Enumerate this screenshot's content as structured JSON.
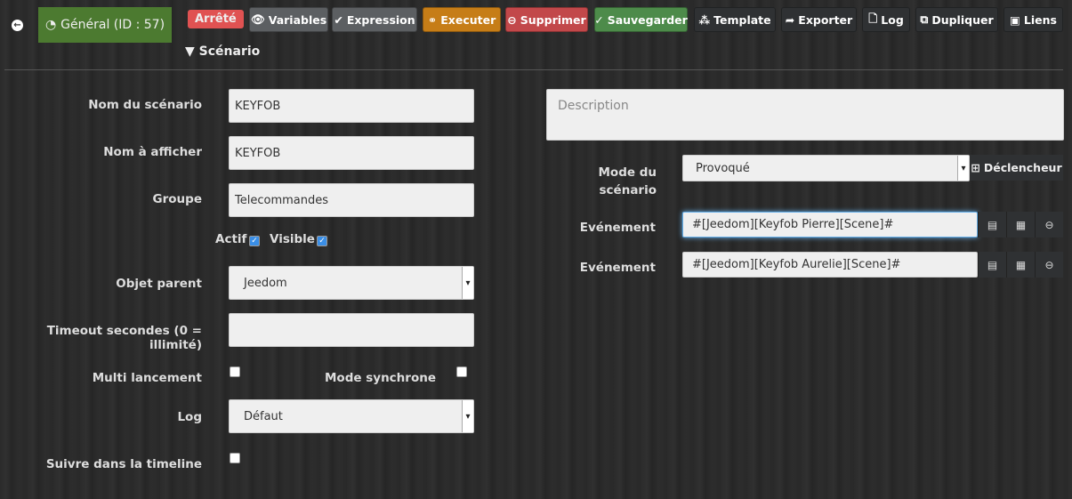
{
  "header": {
    "back_icon": "circle-arrow-left-icon",
    "general_tab": "Général (ID : 57)",
    "status": "Arrêté",
    "scenario_tab": "Scénario",
    "buttons": {
      "variables": "Variables",
      "expression": "Expression",
      "executer": "Executer",
      "supprimer": "Supprimer",
      "sauvegarder": "Sauvegarder",
      "template": "Template",
      "exporter": "Exporter",
      "log": "Log",
      "dupliquer": "Dupliquer",
      "liens": "Liens"
    }
  },
  "colors": {
    "general": "#4c7a30",
    "status": "#e05252",
    "executer": "#c67d17",
    "supprimer": "#c2484a",
    "sauvegarder": "#4d8b4a"
  },
  "form": {
    "nom_label": "Nom du scénario",
    "nom_value": "KEYFOB",
    "afficher_label": "Nom à afficher",
    "afficher_value": "KEYFOB",
    "groupe_label": "Groupe",
    "groupe_value": "Telecommandes",
    "actif_label": "Actif",
    "actif": true,
    "visible_label": "Visible",
    "visible": true,
    "parent_label": "Objet parent",
    "parent_value": "Jeedom",
    "timeout_label": "Timeout secondes (0 = illimité)",
    "timeout_value": "",
    "multi_label": "Multi lancement",
    "multi": false,
    "sync_label": "Mode synchrone",
    "sync": false,
    "log_label": "Log",
    "log_value": "Défaut",
    "timeline_label": "Suivre dans la timeline",
    "timeline": false
  },
  "right": {
    "description_placeholder": "Description",
    "mode_label": "Mode du scénario",
    "mode_value": "Provoqué",
    "declencheur": "Déclencheur",
    "events": [
      {
        "label": "Evénement",
        "value": "#[Jeedom][Keyfob Pierre][Scene]#"
      },
      {
        "label": "Evénement",
        "value": "#[Jeedom][Keyfob Aurelie][Scene]#"
      }
    ]
  }
}
